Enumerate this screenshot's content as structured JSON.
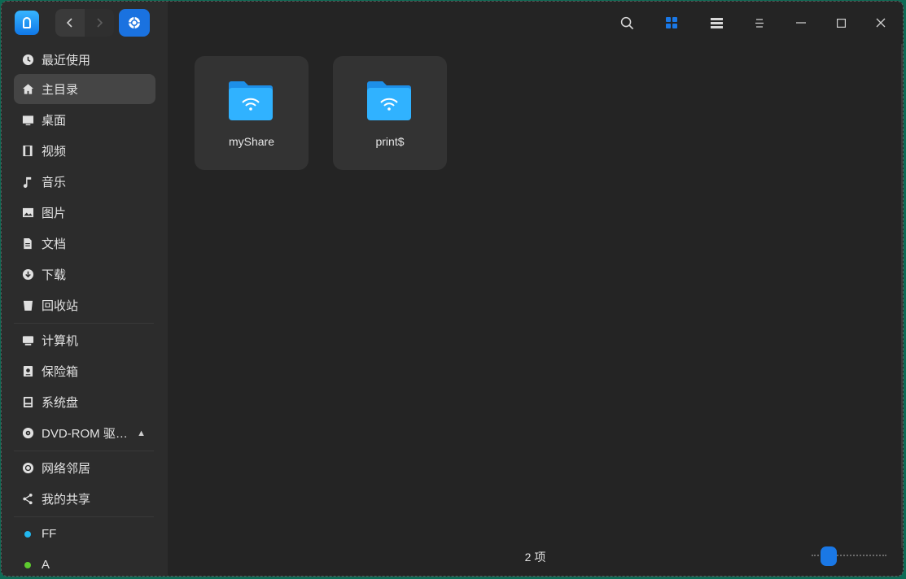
{
  "titlebar": {
    "back_icon": "chevron-left-icon",
    "forward_icon": "chevron-right-icon",
    "breadcrumb_icon": "network-icon",
    "search_icon": "search-icon",
    "icon_view_icon": "grid-view-icon",
    "list_view_icon": "list-view-icon",
    "menu_icon": "menu-icon",
    "minimize_icon": "minimize-icon",
    "maximize_icon": "maximize-icon",
    "close_icon": "close-icon",
    "accent": "#1a72e0"
  },
  "sidebar": {
    "items": [
      {
        "label": "最近使用",
        "icon": "clock-icon"
      },
      {
        "label": "主目录",
        "icon": "home-icon",
        "active": true
      },
      {
        "label": "桌面",
        "icon": "desktop-icon"
      },
      {
        "label": "视频",
        "icon": "film-icon"
      },
      {
        "label": "音乐",
        "icon": "music-icon"
      },
      {
        "label": "图片",
        "icon": "image-icon"
      },
      {
        "label": "文档",
        "icon": "document-icon"
      },
      {
        "label": "下载",
        "icon": "download-icon"
      },
      {
        "label": "回收站",
        "icon": "trash-icon"
      },
      {
        "label": "计算机",
        "icon": "computer-icon"
      },
      {
        "label": "保险箱",
        "icon": "vault-icon"
      },
      {
        "label": "系统盘",
        "icon": "disk-icon"
      },
      {
        "label": "DVD-ROM 驱…",
        "icon": "disc-icon",
        "eject_icon": "eject-icon"
      },
      {
        "label": "网络邻居",
        "icon": "network-icon"
      },
      {
        "label": "我的共享",
        "icon": "share-icon"
      },
      {
        "label": "FF",
        "icon": "tag-dot-icon",
        "color": "#22b8f0"
      },
      {
        "label": "A",
        "icon": "tag-dot-icon",
        "color": "#5ecb2f"
      }
    ]
  },
  "files": [
    {
      "name": "myShare",
      "icon": "network-folder-icon"
    },
    {
      "name": "print$",
      "icon": "network-folder-icon"
    }
  ],
  "status": {
    "count": "2 项",
    "zoom_level": 0.25
  }
}
